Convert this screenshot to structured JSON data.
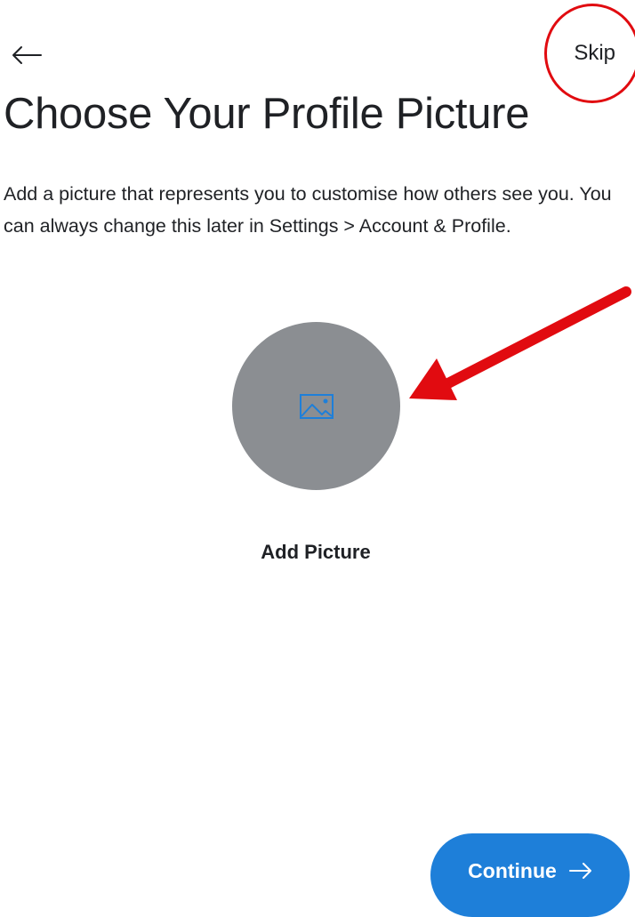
{
  "header": {
    "back_icon": "arrow-left-icon",
    "skip_label": "Skip"
  },
  "title": "Choose Your Profile Picture",
  "description": "Add a picture that represents you to customise how others see you. You can always change this later in Settings > Account & Profile.",
  "avatar": {
    "icon": "image-icon",
    "label": "Add Picture"
  },
  "footer": {
    "continue_label": "Continue",
    "continue_icon": "arrow-right-icon"
  },
  "colors": {
    "primary": "#1e7fd9",
    "avatar_bg": "#8b8e92",
    "annotation": "#e10b10",
    "text": "#1f2125"
  }
}
